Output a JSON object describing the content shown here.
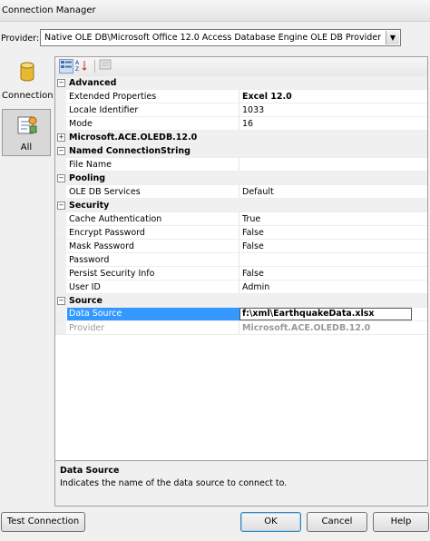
{
  "window": {
    "title": "Connection Manager"
  },
  "provider": {
    "label": "Provider:",
    "value": "Native OLE DB\\Microsoft Office 12.0 Access Database Engine OLE DB Provider"
  },
  "nav": {
    "items": [
      {
        "label": "Connection",
        "icon": "database-icon"
      },
      {
        "label": "All",
        "icon": "properties-icon"
      }
    ]
  },
  "toolbar": {
    "icons": [
      "categorized-icon",
      "alphabetical-icon",
      "property-pages-icon"
    ]
  },
  "grid": {
    "categories": {
      "advanced": {
        "name": "Advanced",
        "toggle": "−",
        "props": [
          {
            "name": "Extended Properties",
            "value": "Excel 12.0"
          },
          {
            "name": "Locale Identifier",
            "value": "1033"
          },
          {
            "name": "Mode",
            "value": "16"
          }
        ]
      },
      "ace": {
        "name": "Microsoft.ACE.OLEDB.12.0",
        "toggle": "+"
      },
      "named": {
        "name": "Named ConnectionString",
        "toggle": "−",
        "props": [
          {
            "name": "File Name",
            "value": ""
          }
        ]
      },
      "pooling": {
        "name": "Pooling",
        "toggle": "−",
        "props": [
          {
            "name": "OLE DB Services",
            "value": "Default"
          }
        ]
      },
      "security": {
        "name": "Security",
        "toggle": "−",
        "props": [
          {
            "name": "Cache Authentication",
            "value": "True"
          },
          {
            "name": "Encrypt Password",
            "value": "False"
          },
          {
            "name": "Mask Password",
            "value": "False"
          },
          {
            "name": "Password",
            "value": ""
          },
          {
            "name": "Persist Security Info",
            "value": "False"
          },
          {
            "name": "User ID",
            "value": "Admin"
          }
        ]
      },
      "source": {
        "name": "Source",
        "toggle": "−",
        "props": [
          {
            "name": "Data Source",
            "value": "f:\\xml\\EarthquakeData.xlsx"
          },
          {
            "name": "Provider",
            "value": "Microsoft.ACE.OLEDB.12.0"
          }
        ]
      }
    }
  },
  "description": {
    "title": "Data Source",
    "text": "Indicates the name of the data source to connect to."
  },
  "buttons": {
    "test": "Test Connection",
    "ok": "OK",
    "cancel": "Cancel",
    "help": "Help"
  },
  "colors": {
    "selection": "#3399ff",
    "panel_bg": "#f0f0f0"
  }
}
